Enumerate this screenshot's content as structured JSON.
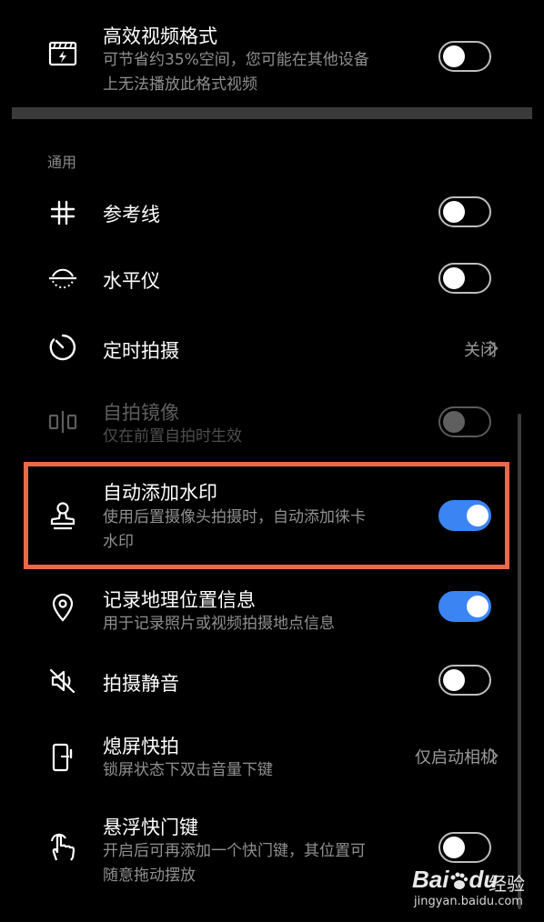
{
  "video_format": {
    "title": "高效视频格式",
    "subtitle_line1": "可节省约35%空间，您可能在其他设备",
    "subtitle_line2": "上无法播放此格式视频",
    "enabled": false
  },
  "section_label": "通用",
  "settings": {
    "grid": {
      "title": "参考线",
      "enabled": false
    },
    "level": {
      "title": "水平仪",
      "enabled": false
    },
    "timer": {
      "title": "定时拍摄",
      "value": "关闭"
    },
    "mirror": {
      "title": "自拍镜像",
      "subtitle": "仅在前置自拍时生效",
      "enabled": false,
      "disabled": true
    },
    "watermark": {
      "title": "自动添加水印",
      "subtitle_line1": "使用后置摄像头拍摄时，自动添加徕卡",
      "subtitle_line2": "水印",
      "enabled": true,
      "highlight_color": "#e8694b"
    },
    "location": {
      "title": "记录地理位置信息",
      "subtitle": "用于记录照片或视频拍摄地点信息",
      "enabled": true
    },
    "mute": {
      "title": "拍摄静音",
      "enabled": false
    },
    "snapshot": {
      "title": "熄屏快拍",
      "subtitle": "锁屏状态下双击音量下键",
      "value": "仅启动相机"
    },
    "floating_shutter": {
      "title": "悬浮快门键",
      "subtitle_line1": "开启后可再添加一个快门键，其位置可",
      "subtitle_line2": "随意拖动摆放",
      "enabled": false
    }
  },
  "watermark_logo": {
    "brand": "Bai",
    "brand2": "du",
    "cn": "经验",
    "url": "jingyan.baidu.com"
  },
  "colors": {
    "accent": "#3a84f4",
    "background": "#000000",
    "highlight": "#e8694b"
  }
}
